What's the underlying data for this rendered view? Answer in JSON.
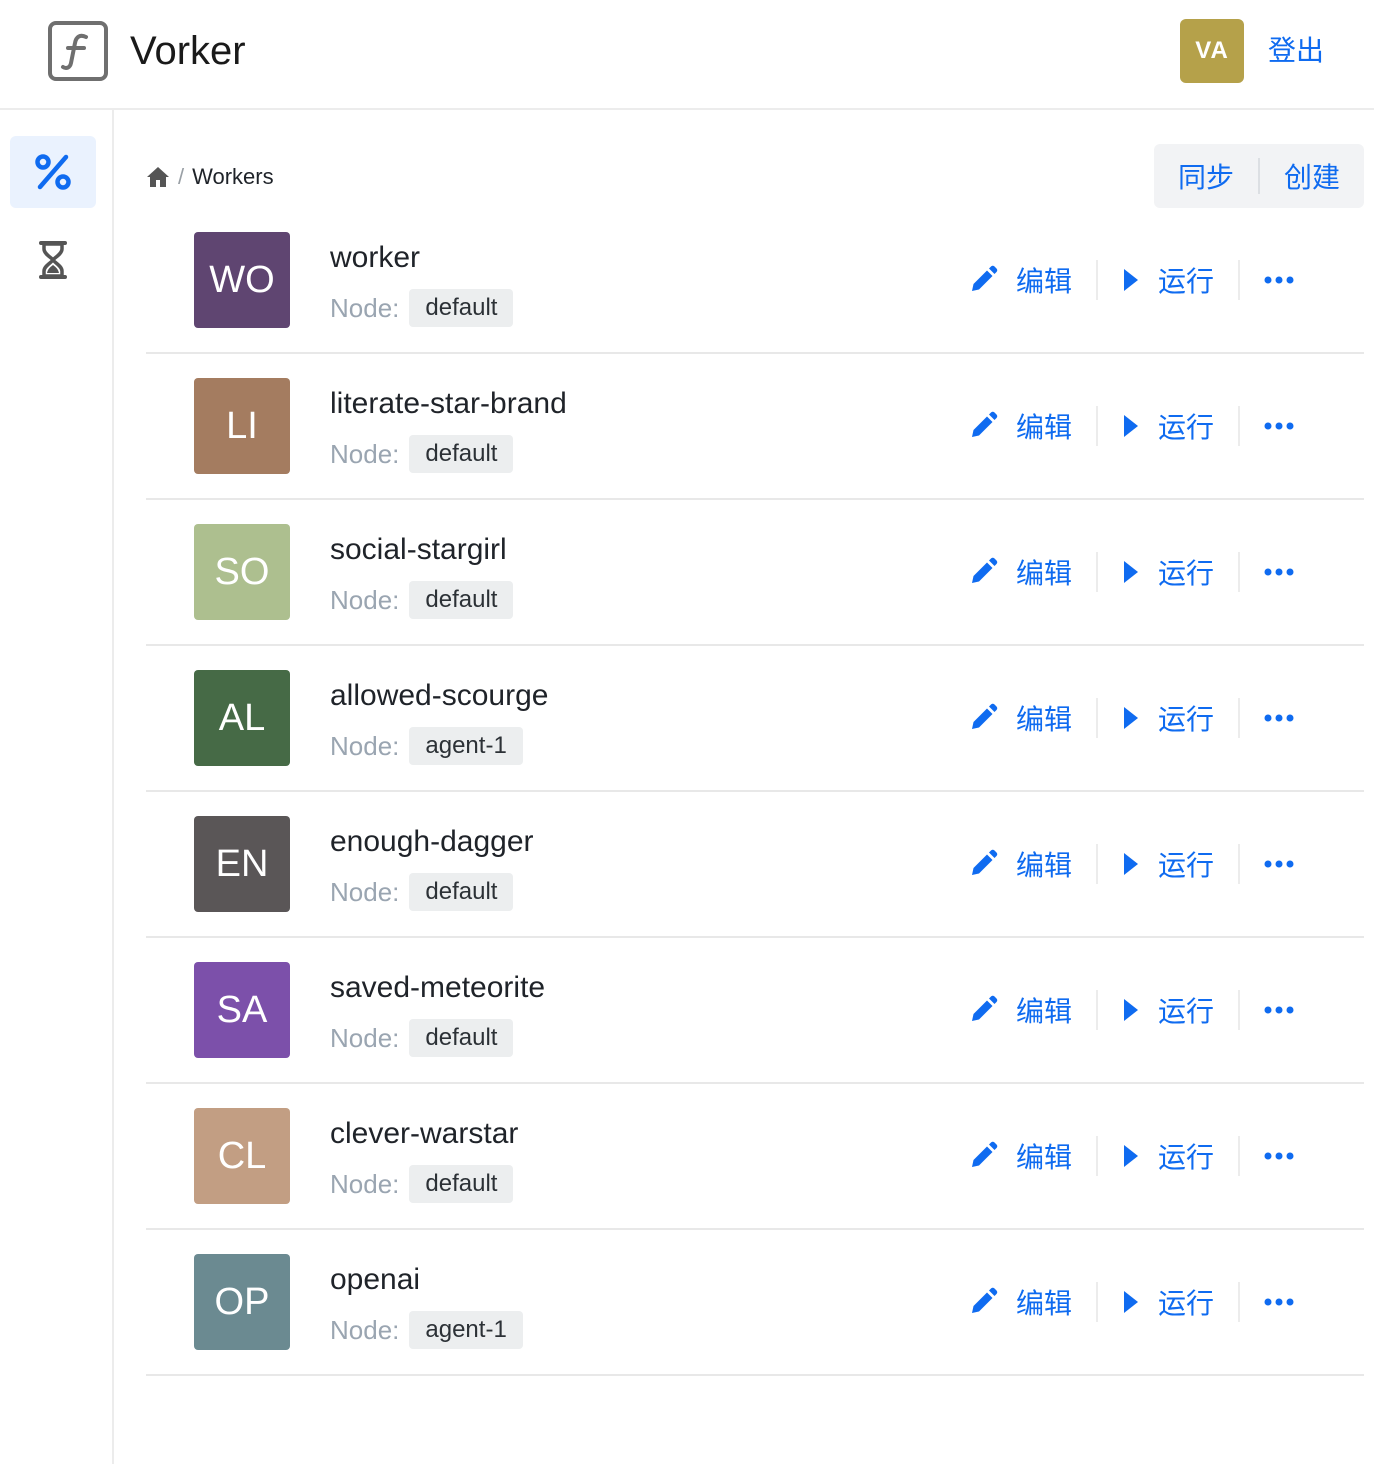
{
  "header": {
    "app_title": "Vorker",
    "user_initials": "VA",
    "logout_label": "登出"
  },
  "sidebar": {
    "items": [
      {
        "icon": "percent-icon",
        "active": true
      },
      {
        "icon": "hourglass-icon",
        "active": false
      }
    ]
  },
  "breadcrumb": {
    "separator": "/",
    "current": "Workers"
  },
  "toolbar": {
    "sync_label": "同步",
    "create_label": "创建"
  },
  "list": {
    "node_label": "Node:",
    "edit_label": "编辑",
    "run_label": "运行",
    "workers": [
      {
        "initials": "WO",
        "name": "worker",
        "node": "default",
        "color": "#5f4571"
      },
      {
        "initials": "LI",
        "name": "literate-star-brand",
        "node": "default",
        "color": "#a47c60"
      },
      {
        "initials": "SO",
        "name": "social-stargirl",
        "node": "default",
        "color": "#adbf8f"
      },
      {
        "initials": "AL",
        "name": "allowed-scourge",
        "node": "agent-1",
        "color": "#466a46"
      },
      {
        "initials": "EN",
        "name": "enough-dagger",
        "node": "default",
        "color": "#5a5657"
      },
      {
        "initials": "SA",
        "name": "saved-meteorite",
        "node": "default",
        "color": "#7c50aa"
      },
      {
        "initials": "CL",
        "name": "clever-warstar",
        "node": "default",
        "color": "#c29e83"
      },
      {
        "initials": "OP",
        "name": "openai",
        "node": "agent-1",
        "color": "#6b8a91"
      }
    ]
  },
  "colors": {
    "accent": "#0f6bf0",
    "active_bg": "#eaf2fe"
  }
}
